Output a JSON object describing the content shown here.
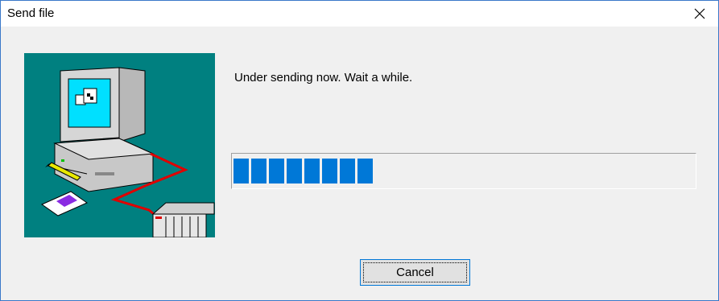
{
  "window": {
    "title": "Send file",
    "close_glyph": "✕"
  },
  "illustration": {
    "icon": "pc-to-plc-transfer-illustration",
    "background": "#008080"
  },
  "main": {
    "message": "Under sending now. Wait a while."
  },
  "progress": {
    "filled_segments": 8,
    "fraction": 0.32,
    "color": "#0078d7"
  },
  "buttons": {
    "cancel_label": "Cancel"
  }
}
